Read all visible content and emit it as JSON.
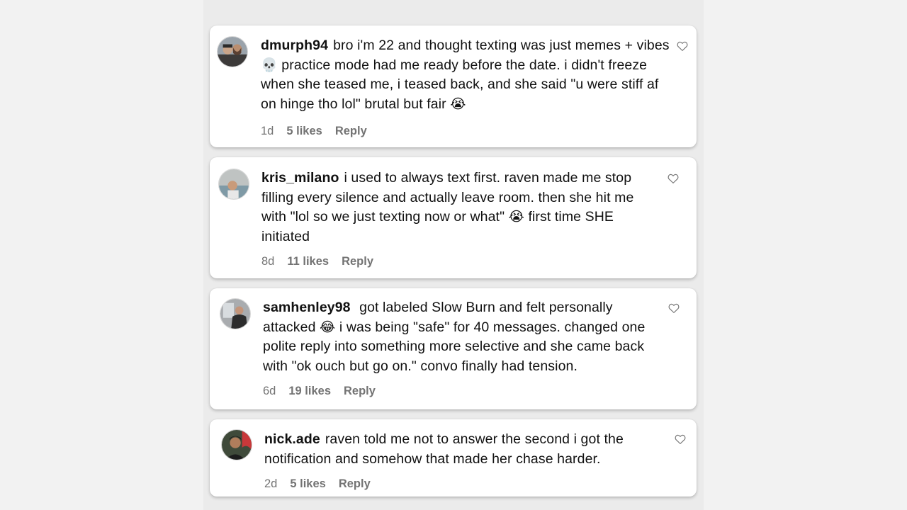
{
  "comments": [
    {
      "username": "dmurph94",
      "text_parts": [
        "bro i'm 22 and thought texting was just memes + vibes ",
        " practice mode had me ready before the date. i didn't freeze when she teased me, i teased back, and she said \"u were stiff af on hinge tho lol\" brutal but fair "
      ],
      "emojis": [
        "💀",
        "😭"
      ],
      "time": "1d",
      "likes": "5 likes",
      "reply_label": "Reply"
    },
    {
      "username": "kris_milano",
      "text_parts": [
        "i used to always text first. raven made me stop filling every silence and actually leave room. then she hit me with \"lol so we just texting now or what\" ",
        " first time SHE initiated"
      ],
      "emojis": [
        "😭"
      ],
      "time": "8d",
      "likes": "11 likes",
      "reply_label": "Reply"
    },
    {
      "username": "samhenley98",
      "text_parts": [
        " got labeled Slow Burn and felt personally attacked ",
        " i was being \"safe\" for 40 messages. changed one polite reply into something more selective and she came back with \"ok ouch but go on.\" convo finally had tension."
      ],
      "emojis": [
        "😂"
      ],
      "time": "6d",
      "likes": "19 likes",
      "reply_label": "Reply"
    },
    {
      "username": "nick.ade",
      "text_parts": [
        "raven told me not to answer the second i got the notification and somehow that made her chase harder."
      ],
      "emojis": [],
      "time": "2d",
      "likes": "5 likes",
      "reply_label": "Reply"
    }
  ],
  "icons": {
    "like": "heart-outline-icon"
  },
  "colors": {
    "meta_text": "#737373",
    "card_bg": "#ffffff",
    "page_bg": "#f2f2f2"
  }
}
